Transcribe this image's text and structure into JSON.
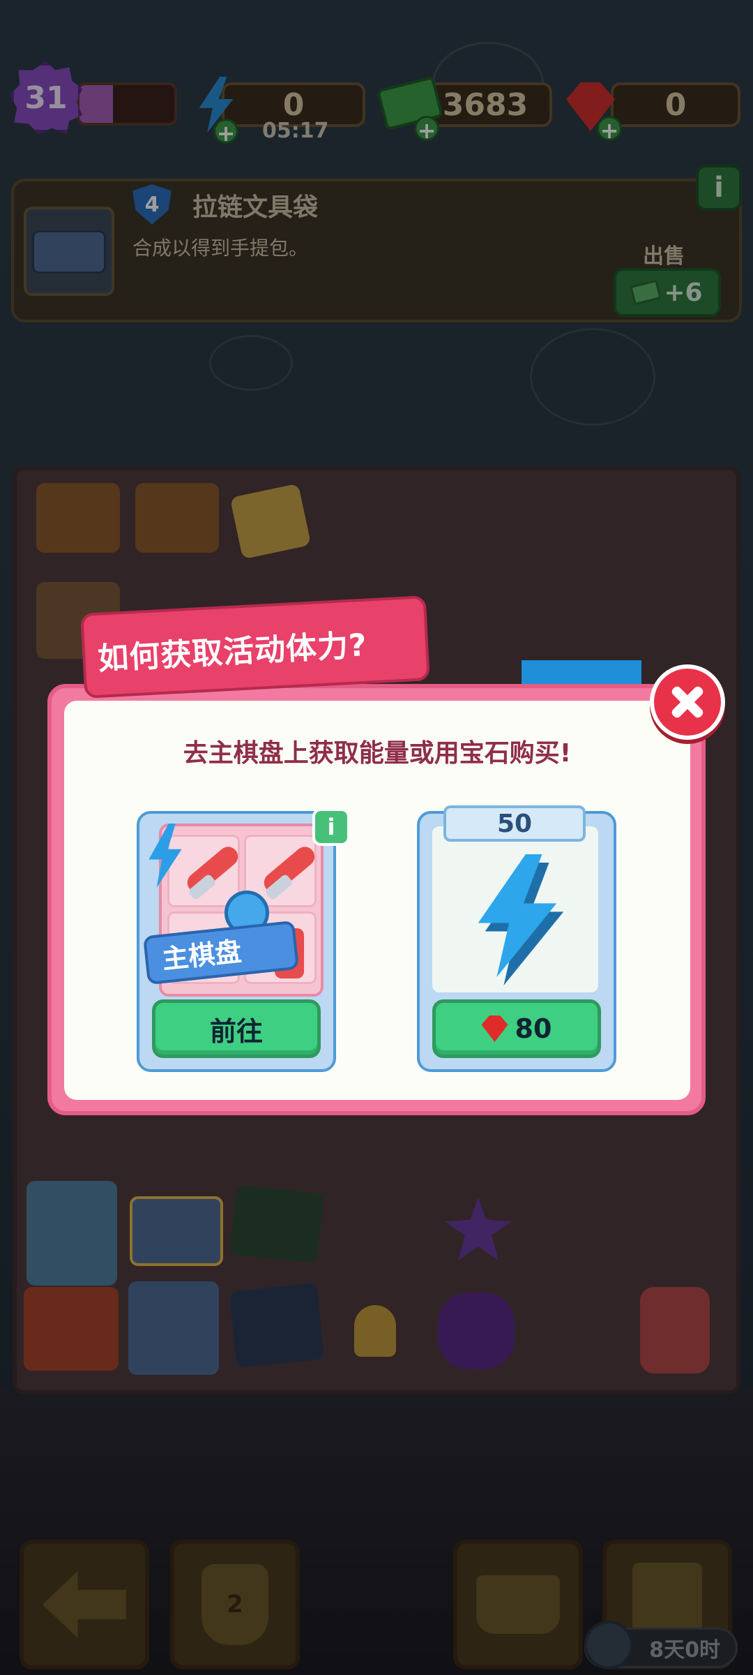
{
  "top_bar": {
    "level": "31",
    "xp_fraction": 0.35,
    "energy": {
      "value": "0",
      "timer": "05:17"
    },
    "cash": {
      "value": "3683"
    },
    "gems": {
      "value": "0"
    }
  },
  "info_panel": {
    "level_badge": "4",
    "title": "拉链文具袋",
    "description": "合成以得到手提包。",
    "sell_label": "出售",
    "sell_value": "+6",
    "info_button": "i"
  },
  "dialog": {
    "title": "如何获取活动体力?",
    "subtitle": "去主棋盘上获取能量或用宝石购买!",
    "option_main_board": {
      "label": "主棋盘",
      "info_button": "i",
      "button_label": "前往"
    },
    "option_buy": {
      "amount": "50",
      "price": "80"
    }
  },
  "bottom_bar": {
    "trophy_number": "2",
    "event_timer": "8天0时"
  },
  "colors": {
    "accent_pink": "#e8416a",
    "green_button": "#3fcf82",
    "close_red": "#e8324a",
    "energy_blue": "#2ea6ec"
  }
}
